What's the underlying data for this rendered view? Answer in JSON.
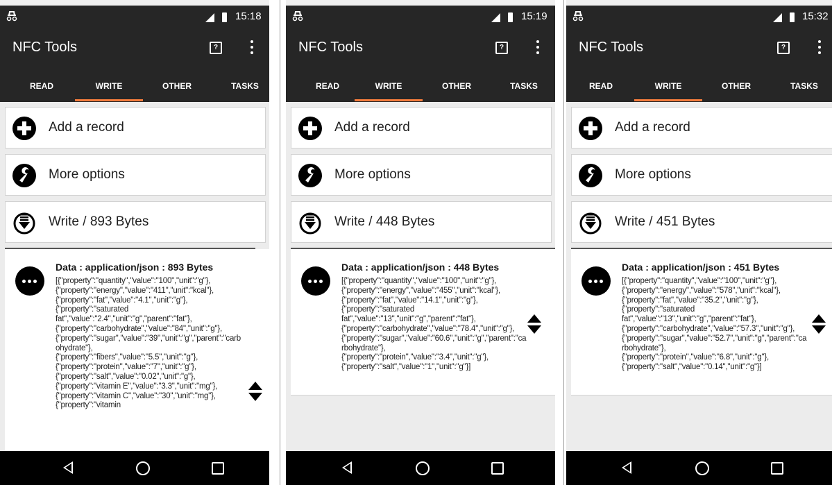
{
  "screens": [
    {
      "status_time": "15:18",
      "app_title": "NFC Tools",
      "tabs": [
        "READ",
        "WRITE",
        "OTHER",
        "TASKS"
      ],
      "active_tab": "WRITE",
      "cards": [
        "Add a record",
        "More options",
        "Write / 893 Bytes"
      ],
      "record_title": "Data : application/json : 893 Bytes",
      "record_body": "[{\"property\":\"quantity\",\"value\":\"100\",\"unit\":\"g\"},\n{\"property\":\"energy\",\"value\":\"411\",\"unit\":\"kcal\"},\n{\"property\":\"fat\",\"value\":\"4.1\",\"unit\":\"g\"},\n{\"property\":\"saturated fat\",\"value\":\"2.4\",\"unit\":\"g\",\"parent\":\"fat\"},\n{\"property\":\"carbohydrate\",\"value\":\"84\",\"unit\":\"g\"},{\"property\":\"sugar\",\"value\":\"39\",\"unit\":\"g\",\"parent\":\"carbohydrate\"},\n{\"property\":\"fibers\",\"value\":\"5.5\",\"unit\":\"g\"},\n{\"property\":\"protein\",\"value\":\"7\",\"unit\":\"g\"},\n{\"property\":\"salt\",\"value\":\"0.02\",\"unit\":\"g\"},\n{\"property\":\"vitamin E\",\"value\":\"3.3\",\"unit\":\"mg\"},\n{\"property\":\"vitamin C\",\"value\":\"30\",\"unit\":\"mg\"},\n{\"property\":\"vitamin"
    },
    {
      "status_time": "15:19",
      "app_title": "NFC Tools",
      "tabs": [
        "READ",
        "WRITE",
        "OTHER",
        "TASKS"
      ],
      "active_tab": "WRITE",
      "cards": [
        "Add a record",
        "More options",
        "Write / 448 Bytes"
      ],
      "record_title": "Data : application/json : 448 Bytes",
      "record_body": "[{\"property\":\"quantity\",\"value\":\"100\",\"unit\":\"g\"},\n{\"property\":\"energy\",\"value\":\"455\",\"unit\":\"kcal\"},\n{\"property\":\"fat\",\"value\":\"14.1\",\"unit\":\"g\"},\n{\"property\":\"saturated fat\",\"value\":\"13\",\"unit\":\"g\",\"parent\":\"fat\"},\n{\"property\":\"carbohydrate\",\"value\":\"78.4\",\"unit\":\"g\"},{\"property\":\"sugar\",\"value\":\"60.6\",\"unit\":\"g\",\"parent\":\"carbohydrate\"},\n{\"property\":\"protein\",\"value\":\"3.4\",\"unit\":\"g\"},\n{\"property\":\"salt\",\"value\":\"1\",\"unit\":\"g\"}]"
    },
    {
      "status_time": "15:32",
      "app_title": "NFC Tools",
      "tabs": [
        "READ",
        "WRITE",
        "OTHER",
        "TASKS"
      ],
      "active_tab": "WRITE",
      "cards": [
        "Add a record",
        "More options",
        "Write / 451 Bytes"
      ],
      "record_title": "Data : application/json : 451 Bytes",
      "record_body": "[{\"property\":\"quantity\",\"value\":\"100\",\"unit\":\"g\"},\n{\"property\":\"energy\",\"value\":\"578\",\"unit\":\"kcal\"},\n{\"property\":\"fat\",\"value\":\"35.2\",\"unit\":\"g\"},\n{\"property\":\"saturated fat\",\"value\":\"13\",\"unit\":\"g\",\"parent\":\"fat\"},\n{\"property\":\"carbohydrate\",\"value\":\"57.3\",\"unit\":\"g\"},{\"property\":\"sugar\",\"value\":\"52.7\",\"unit\":\"g\",\"parent\":\"carbohydrate\"},\n{\"property\":\"protein\",\"value\":\"6.8\",\"unit\":\"g\"},\n{\"property\":\"salt\",\"value\":\"0.14\",\"unit\":\"g\"}]"
    }
  ],
  "colors": {
    "appbar": "#262626",
    "tab_indicator": "#f47c3c",
    "background": "#ececec",
    "navbar": "#000000"
  },
  "icons": [
    "incognito-icon",
    "signal-icon",
    "battery-icon",
    "help-icon",
    "overflow-menu-icon",
    "add-icon",
    "wrench-icon",
    "write-download-icon",
    "more-icon",
    "reorder-icon",
    "back-icon",
    "home-icon",
    "recents-icon"
  ]
}
